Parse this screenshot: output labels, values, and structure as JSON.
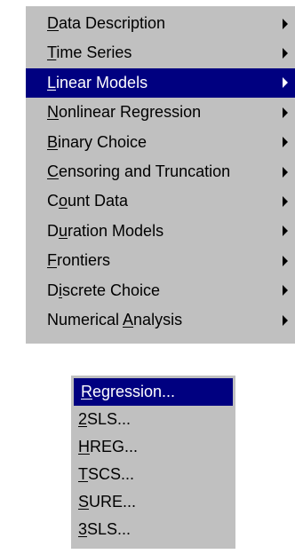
{
  "main_menu": {
    "items": [
      {
        "label": "Data Description",
        "accel": "D",
        "selected": false,
        "has_submenu": true
      },
      {
        "label": "Time Series",
        "accel": "T",
        "selected": false,
        "has_submenu": true
      },
      {
        "label": "Linear Models",
        "accel": "L",
        "selected": true,
        "has_submenu": true
      },
      {
        "label": "Nonlinear Regression",
        "accel": "N",
        "selected": false,
        "has_submenu": true
      },
      {
        "label": "Binary Choice",
        "accel": "B",
        "selected": false,
        "has_submenu": true
      },
      {
        "label": "Censoring and Truncation",
        "accel": "C",
        "selected": false,
        "has_submenu": true
      },
      {
        "label": "Count Data",
        "accel": "o",
        "selected": false,
        "has_submenu": true
      },
      {
        "label": "Duration Models",
        "accel": "u",
        "selected": false,
        "has_submenu": true
      },
      {
        "label": "Frontiers",
        "accel": "F",
        "selected": false,
        "has_submenu": true
      },
      {
        "label": "Discrete Choice",
        "accel": "i",
        "selected": false,
        "has_submenu": true
      },
      {
        "label": "Numerical Analysis",
        "accel": "A",
        "selected": false,
        "has_submenu": true
      }
    ]
  },
  "sub_menu": {
    "items": [
      {
        "label": "Regression...",
        "accel": "R",
        "selected": true
      },
      {
        "label": "2SLS...",
        "accel": "2",
        "selected": false
      },
      {
        "label": "HREG...",
        "accel": "H",
        "selected": false
      },
      {
        "label": "TSCS...",
        "accel": "T",
        "selected": false
      },
      {
        "label": "SURE...",
        "accel": "S",
        "selected": false
      },
      {
        "label": "3SLS...",
        "accel": "3",
        "selected": false
      }
    ]
  },
  "colors": {
    "menu_background": "#c0c0c0",
    "selection": "#000080",
    "text": "#000000",
    "selected_text": "#ffffff"
  }
}
